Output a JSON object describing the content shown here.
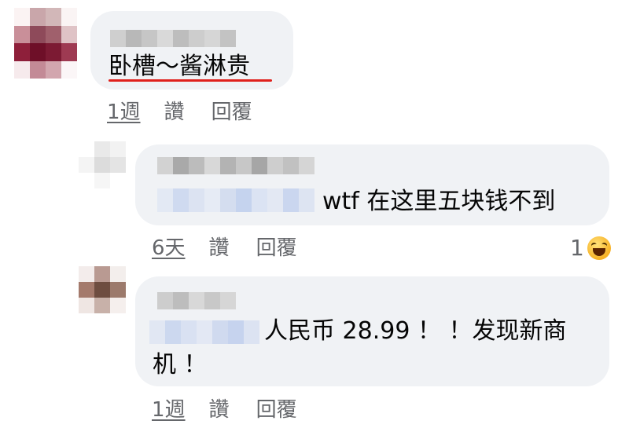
{
  "comments": [
    {
      "text": "卧槽～酱淋贵",
      "time": "1週",
      "like": "讚",
      "reply": "回覆"
    },
    {
      "text": "wtf 在这里五块钱不到",
      "time": "6天",
      "like": "讚",
      "reply": "回覆",
      "reaction_count": "1",
      "reaction_icon": "haha-emoji-icon"
    },
    {
      "text_line1": "人民币 28.99 ！ ！发现新商",
      "text_line2": "机 ！",
      "time": "1週",
      "like": "讚",
      "reply": "回覆"
    }
  ]
}
